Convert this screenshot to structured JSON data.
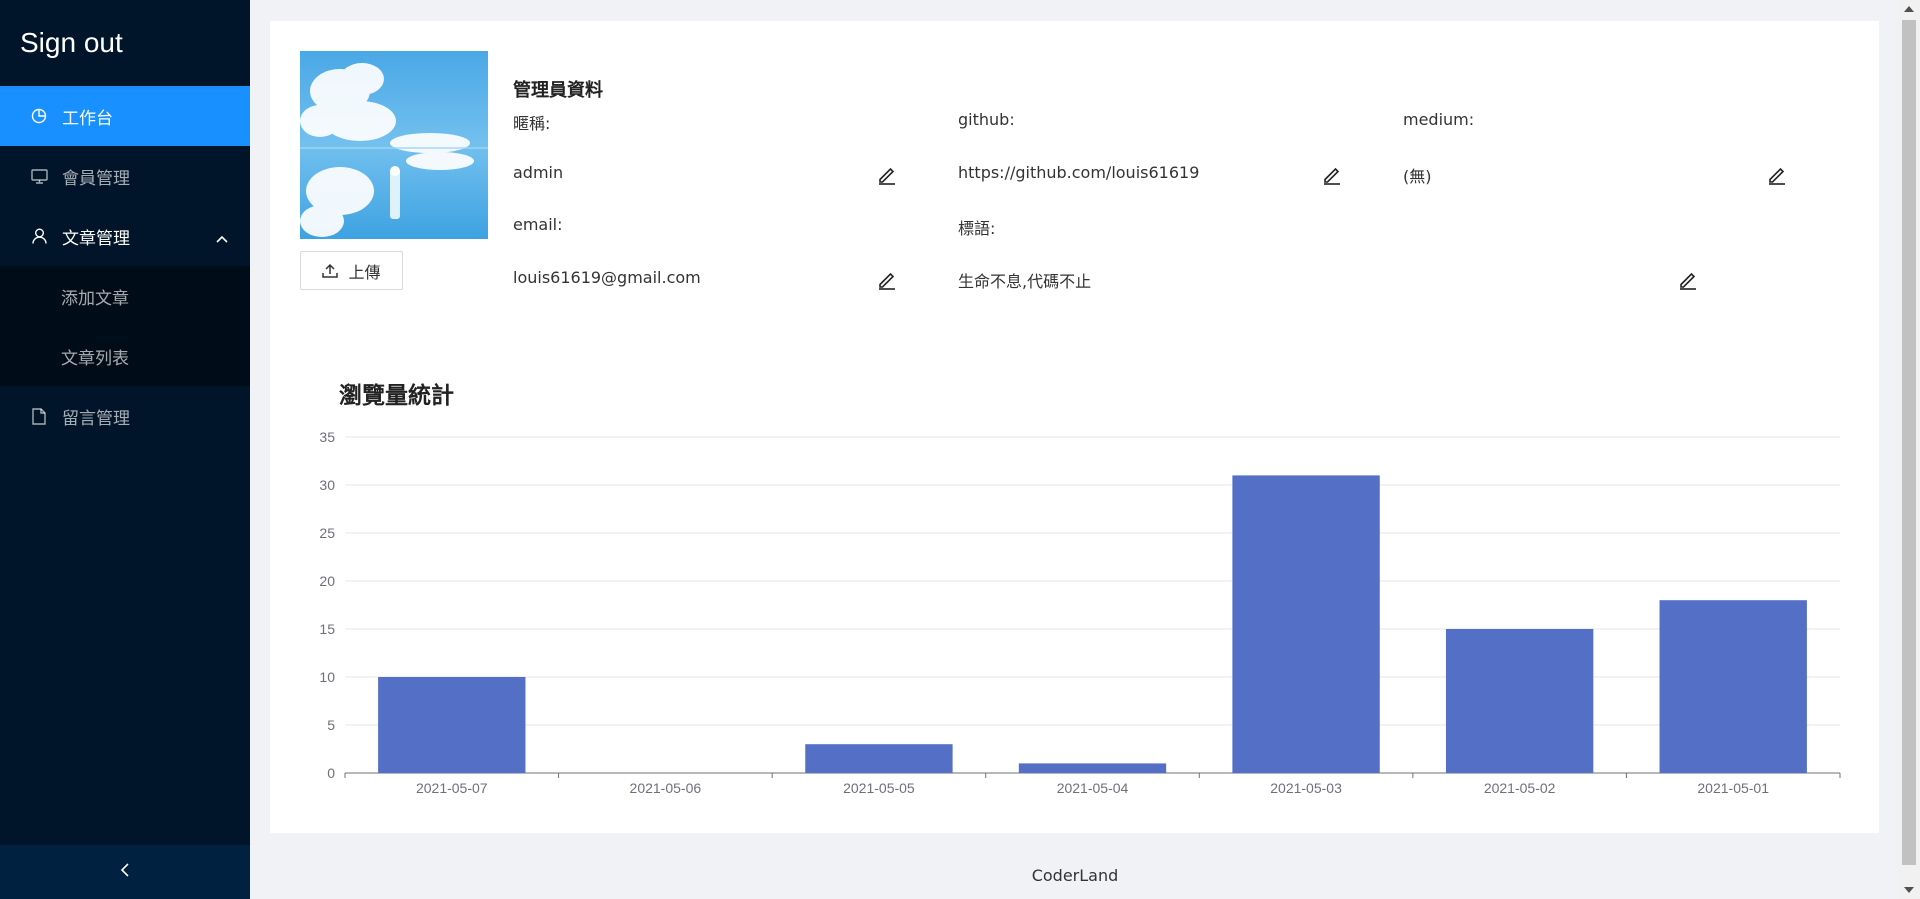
{
  "sidebar": {
    "logo": "Sign out",
    "items": [
      {
        "label": "工作台",
        "icon": "pie-chart-icon"
      },
      {
        "label": "會員管理",
        "icon": "desktop-icon"
      },
      {
        "label": "文章管理",
        "icon": "user-icon"
      },
      {
        "label": "留言管理",
        "icon": "file-icon"
      }
    ],
    "submenu": [
      {
        "label": "添加文章"
      },
      {
        "label": "文章列表"
      }
    ],
    "collapse_icon": "chevron-left-icon"
  },
  "profile": {
    "title": "管理員資料",
    "upload_label": "上傳",
    "fields": {
      "nickname": {
        "label": "暱稱:",
        "value": "admin"
      },
      "github": {
        "label": "github:",
        "value": "https://github.com/louis61619"
      },
      "medium": {
        "label": "medium:",
        "value": "(無)"
      },
      "email": {
        "label": "email:",
        "value": "louis61619@gmail.com"
      },
      "slogan": {
        "label": "標語:",
        "value": "生命不息,代碼不止"
      }
    }
  },
  "chart_data": {
    "type": "bar",
    "title": "瀏覽量統計",
    "categories": [
      "2021-05-07",
      "2021-05-06",
      "2021-05-05",
      "2021-05-04",
      "2021-05-03",
      "2021-05-02",
      "2021-05-01"
    ],
    "values": [
      10,
      0,
      3,
      1,
      31,
      15,
      18
    ],
    "ylim": [
      0,
      35
    ],
    "yticks": [
      0,
      5,
      10,
      15,
      20,
      25,
      30,
      35
    ],
    "grid": true,
    "bar_color": "#5470c6",
    "xlabel": "",
    "ylabel": ""
  },
  "footer": "CoderLand",
  "colors": {
    "sidebar_bg": "#001529",
    "active": "#1890ff",
    "bar": "#5470c6"
  }
}
